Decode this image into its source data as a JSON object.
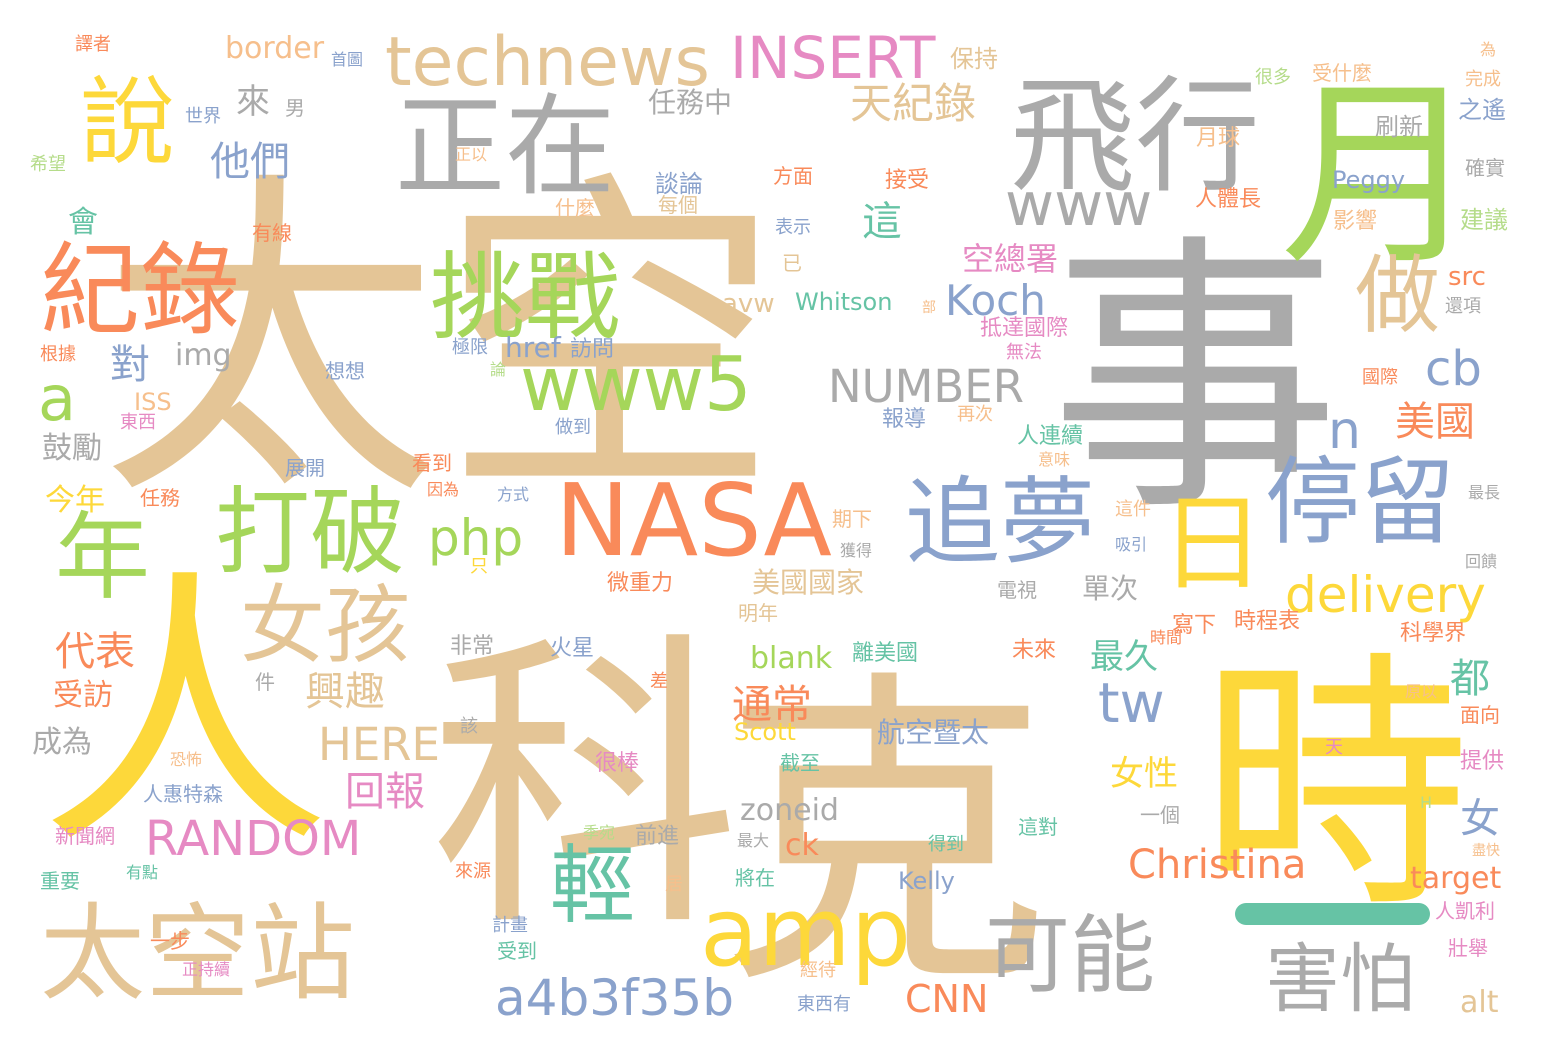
{
  "palette": {
    "tan": "#e4c596",
    "gray": "#aaaaaa",
    "yellow": "#fdd83a",
    "green": "#a5d65a",
    "orange": "#f98a5a",
    "blue": "#8aa2cc",
    "teal": "#66c3a5",
    "pink": "#e68ac3",
    "lightgreen": "#b5dc8a",
    "peach": "#f6bf8c"
  },
  "words": [
    {
      "text": "太空",
      "color": "tan"
    },
    {
      "text": "事",
      "color": "gray"
    },
    {
      "text": "人",
      "color": "yellow"
    },
    {
      "text": "科",
      "color": "tan"
    },
    {
      "text": "克",
      "color": "tan"
    },
    {
      "text": "時",
      "color": "yellow"
    },
    {
      "text": "月",
      "color": "green"
    },
    {
      "text": "飛行",
      "color": "gray"
    },
    {
      "text": "正在",
      "color": "gray"
    },
    {
      "text": "說",
      "color": "yellow"
    },
    {
      "text": "technews",
      "color": "tan"
    },
    {
      "text": "INSERT",
      "color": "pink"
    },
    {
      "text": "紀錄",
      "color": "orange"
    },
    {
      "text": "挑戰",
      "color": "green"
    },
    {
      "text": "做",
      "color": "tan"
    },
    {
      "text": "www",
      "color": "gray"
    },
    {
      "text": "www5",
      "color": "green"
    },
    {
      "text": "停留",
      "color": "blue"
    },
    {
      "text": "追夢",
      "color": "blue"
    },
    {
      "text": "打破",
      "color": "green"
    },
    {
      "text": "NASA",
      "color": "orange"
    },
    {
      "text": "日",
      "color": "yellow"
    },
    {
      "text": "年",
      "color": "green"
    },
    {
      "text": "女孩",
      "color": "tan"
    },
    {
      "text": "太空站",
      "color": "tan"
    },
    {
      "text": "amp",
      "color": "yellow"
    },
    {
      "text": "可能",
      "color": "gray"
    },
    {
      "text": "害怕",
      "color": "gray"
    },
    {
      "text": "輕",
      "color": "teal"
    },
    {
      "text": "a4b3f35b",
      "color": "blue"
    },
    {
      "text": "delivery",
      "color": "yellow"
    },
    {
      "text": "php",
      "color": "green"
    },
    {
      "text": "RANDOM",
      "color": "pink"
    },
    {
      "text": "NUMBER",
      "color": "gray"
    },
    {
      "text": "Christina",
      "color": "orange"
    },
    {
      "text": "tw",
      "color": "blue"
    },
    {
      "text": "Koch",
      "color": "blue"
    },
    {
      "text": "HERE",
      "color": "tan"
    },
    {
      "text": "cb",
      "color": "blue"
    },
    {
      "text": "a",
      "color": "green"
    },
    {
      "text": "n",
      "color": "blue"
    },
    {
      "text": "天紀錄",
      "color": "tan"
    },
    {
      "text": "他們",
      "color": "blue"
    },
    {
      "text": "興趣",
      "color": "tan"
    },
    {
      "text": "代表",
      "color": "orange"
    },
    {
      "text": "回報",
      "color": "pink"
    },
    {
      "text": "通常",
      "color": "orange"
    },
    {
      "text": "航空暨太",
      "color": "blue"
    },
    {
      "text": "美國",
      "color": "orange"
    },
    {
      "text": "CNN",
      "color": "orange"
    },
    {
      "text": "zoneid",
      "color": "gray"
    },
    {
      "text": "都",
      "color": "teal"
    },
    {
      "text": "女",
      "color": "blue"
    },
    {
      "text": "女性",
      "color": "yellow"
    },
    {
      "text": "最久",
      "color": "teal"
    },
    {
      "text": "這",
      "color": "teal"
    },
    {
      "text": "對",
      "color": "blue"
    },
    {
      "text": "會",
      "color": "teal"
    },
    {
      "text": "來",
      "color": "gray"
    },
    {
      "text": "border",
      "color": "peach"
    },
    {
      "text": "任務中",
      "color": "gray"
    },
    {
      "text": "空總署",
      "color": "pink"
    },
    {
      "text": "blank",
      "color": "green"
    },
    {
      "text": "target",
      "color": "orange"
    },
    {
      "text": "美國國家",
      "color": "tan"
    },
    {
      "text": "單次",
      "color": "gray"
    },
    {
      "text": "img",
      "color": "gray"
    },
    {
      "text": "href",
      "color": "blue"
    },
    {
      "text": "avw",
      "color": "tan"
    },
    {
      "text": "Whitson",
      "color": "teal"
    },
    {
      "text": "src",
      "color": "orange"
    },
    {
      "text": "ck",
      "color": "orange"
    },
    {
      "text": "alt",
      "color": "tan"
    },
    {
      "text": "受訪",
      "color": "orange"
    },
    {
      "text": "成為",
      "color": "gray"
    },
    {
      "text": "鼓勵",
      "color": "gray"
    },
    {
      "text": "今年",
      "color": "yellow"
    },
    {
      "text": "Peggy",
      "color": "blue"
    },
    {
      "text": "Scott",
      "color": "yellow"
    },
    {
      "text": "Kelly",
      "color": "blue"
    },
    {
      "text": "ISS",
      "color": "peach"
    },
    {
      "text": "男",
      "color": "gray"
    },
    {
      "text": "世界",
      "color": "blue"
    },
    {
      "text": "首圖",
      "color": "blue"
    },
    {
      "text": "保持",
      "color": "tan"
    },
    {
      "text": "譯者",
      "color": "orange"
    },
    {
      "text": "希望",
      "color": "lightgreen"
    },
    {
      "text": "正以",
      "color": "peach"
    },
    {
      "text": "很多",
      "color": "lightgreen"
    },
    {
      "text": "受什麼",
      "color": "peach"
    },
    {
      "text": "為",
      "color": "peach"
    },
    {
      "text": "完成",
      "color": "peach"
    },
    {
      "text": "之遙",
      "color": "blue"
    },
    {
      "text": "刷新",
      "color": "gray"
    },
    {
      "text": "月球",
      "color": "peach"
    },
    {
      "text": "確實",
      "color": "gray"
    },
    {
      "text": "建議",
      "color": "lightgreen"
    },
    {
      "text": "影響",
      "color": "peach"
    },
    {
      "text": "談論",
      "color": "blue"
    },
    {
      "text": "每個",
      "color": "tan"
    },
    {
      "text": "什麼",
      "color": "peach"
    },
    {
      "text": "方面",
      "color": "orange"
    },
    {
      "text": "接受",
      "color": "orange"
    },
    {
      "text": "表示",
      "color": "blue"
    },
    {
      "text": "有線",
      "color": "orange"
    },
    {
      "text": "已",
      "color": "tan"
    },
    {
      "text": "人體長",
      "color": "orange"
    },
    {
      "text": "還項",
      "color": "gray"
    },
    {
      "text": "部",
      "color": "peach"
    },
    {
      "text": "抵達國際",
      "color": "pink"
    },
    {
      "text": "無法",
      "color": "pink"
    },
    {
      "text": "根據",
      "color": "orange"
    },
    {
      "text": "極限",
      "color": "blue"
    },
    {
      "text": "訪問",
      "color": "blue"
    },
    {
      "text": "想想",
      "color": "blue"
    },
    {
      "text": "論",
      "color": "lightgreen"
    },
    {
      "text": "國際",
      "color": "orange"
    },
    {
      "text": "東西",
      "color": "pink"
    },
    {
      "text": "報導",
      "color": "blue"
    },
    {
      "text": "再次",
      "color": "peach"
    },
    {
      "text": "做到",
      "color": "blue"
    },
    {
      "text": "人連續",
      "color": "teal"
    },
    {
      "text": "意味",
      "color": "peach"
    },
    {
      "text": "展開",
      "color": "blue"
    },
    {
      "text": "看到",
      "color": "orange"
    },
    {
      "text": "任務",
      "color": "orange"
    },
    {
      "text": "因為",
      "color": "orange"
    },
    {
      "text": "方式",
      "color": "blue"
    },
    {
      "text": "期下",
      "color": "peach"
    },
    {
      "text": "這件",
      "color": "peach"
    },
    {
      "text": "最長",
      "color": "gray"
    },
    {
      "text": "獲得",
      "color": "gray"
    },
    {
      "text": "吸引",
      "color": "blue"
    },
    {
      "text": "回饋",
      "color": "gray"
    },
    {
      "text": "只",
      "color": "yellow"
    },
    {
      "text": "微重力",
      "color": "orange"
    },
    {
      "text": "電視",
      "color": "gray"
    },
    {
      "text": "明年",
      "color": "tan"
    },
    {
      "text": "寫下",
      "color": "orange"
    },
    {
      "text": "時程表",
      "color": "orange"
    },
    {
      "text": "時間",
      "color": "orange"
    },
    {
      "text": "科學界",
      "color": "orange"
    },
    {
      "text": "離美國",
      "color": "teal"
    },
    {
      "text": "未來",
      "color": "orange"
    },
    {
      "text": "非常",
      "color": "gray"
    },
    {
      "text": "火星",
      "color": "blue"
    },
    {
      "text": "件",
      "color": "gray"
    },
    {
      "text": "差",
      "color": "orange"
    },
    {
      "text": "原以",
      "color": "peach"
    },
    {
      "text": "面向",
      "color": "orange"
    },
    {
      "text": "該",
      "color": "gray"
    },
    {
      "text": "恐怖",
      "color": "peach"
    },
    {
      "text": "很棒",
      "color": "pink"
    },
    {
      "text": "截至",
      "color": "teal"
    },
    {
      "text": "天",
      "color": "pink"
    },
    {
      "text": "提供",
      "color": "pink"
    },
    {
      "text": "人惠特森",
      "color": "blue"
    },
    {
      "text": "H",
      "color": "lightgreen"
    },
    {
      "text": "一個",
      "color": "gray"
    },
    {
      "text": "新聞網",
      "color": "pink"
    },
    {
      "text": "季宛",
      "color": "lightgreen"
    },
    {
      "text": "前進",
      "color": "gray"
    },
    {
      "text": "最大",
      "color": "gray"
    },
    {
      "text": "得到",
      "color": "teal"
    },
    {
      "text": "這對",
      "color": "teal"
    },
    {
      "text": "盡快",
      "color": "peach"
    },
    {
      "text": "重要",
      "color": "teal"
    },
    {
      "text": "有點",
      "color": "teal"
    },
    {
      "text": "來源",
      "color": "orange"
    },
    {
      "text": "居",
      "color": "peach"
    },
    {
      "text": "將在",
      "color": "teal"
    },
    {
      "text": "人凱利",
      "color": "pink"
    },
    {
      "text": "一步",
      "color": "orange"
    },
    {
      "text": "計畫",
      "color": "blue"
    },
    {
      "text": "壯舉",
      "color": "pink"
    },
    {
      "text": "正持續",
      "color": "pink"
    },
    {
      "text": "受到",
      "color": "teal"
    },
    {
      "text": "經待",
      "color": "peach"
    },
    {
      "text": "東西有",
      "color": "blue"
    }
  ]
}
